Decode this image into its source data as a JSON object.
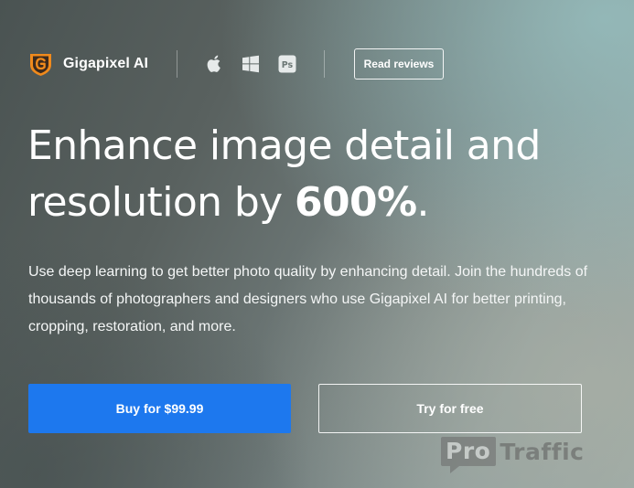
{
  "header": {
    "product_name": "Gigapixel AI",
    "logo_icon": "gigapixel-logo-icon",
    "platform_icons": [
      "apple-icon",
      "windows-icon",
      "photoshop-icon"
    ],
    "photoshop_icon_text": "Ps",
    "read_reviews_label": "Read reviews"
  },
  "hero": {
    "headline_line1": "Enhance image detail and",
    "headline_line2_prefix": "resolution by",
    "headline_emphasis": "600%",
    "headline_suffix": ".",
    "description": "Use deep learning to get better photo quality by enhancing detail. Join the hundreds of thousands of photographers and designers who use Gigapixel AI for better printing, cropping, restoration, and more."
  },
  "cta": {
    "buy_label": "Buy for $99.99",
    "try_label": "Try for free"
  },
  "watermark": {
    "part1": "Pro",
    "part2": "Traffic"
  },
  "colors": {
    "accent_blue": "#1d78ee",
    "logo_orange": "#f08a1c",
    "logo_dark": "#3b2a1e"
  }
}
